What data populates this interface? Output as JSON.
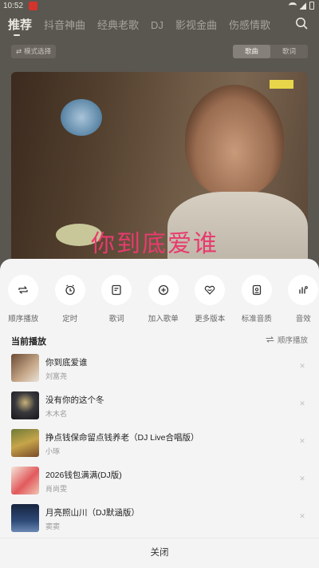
{
  "status_bar": {
    "time": "10:52"
  },
  "top_tabs": [
    "推荐",
    "抖音神曲",
    "经典老歌",
    "DJ",
    "影视金曲",
    "伤感情歌"
  ],
  "header": {
    "mode_label": "模式选择",
    "segments": [
      "歌曲",
      "歌词"
    ]
  },
  "cover": {
    "title_text": "你到底爱谁",
    "label_text": ""
  },
  "actions": [
    {
      "label": "顺序播放",
      "icon": "repeat-icon"
    },
    {
      "label": "定时",
      "icon": "timer-icon"
    },
    {
      "label": "歌词",
      "icon": "lyrics-icon"
    },
    {
      "label": "加入歌单",
      "icon": "add-icon"
    },
    {
      "label": "更多版本",
      "icon": "heart-versions-icon"
    },
    {
      "label": "标准音质",
      "icon": "quality-icon"
    },
    {
      "label": "音效",
      "icon": "sound-effect-icon"
    }
  ],
  "queue": {
    "title": "当前播放",
    "order_label": "顺序播放",
    "songs": [
      {
        "title": "你到底爱谁",
        "artist": "刘富尧"
      },
      {
        "title": "没有你的这个冬",
        "artist": "木木名"
      },
      {
        "title": "挣点钱保命留点钱养老（DJ Live合唱版）",
        "artist": "小琢"
      },
      {
        "title": "2026钱包满满(DJ版)",
        "artist": "肖尚雯"
      },
      {
        "title": "月亮照山川（DJ默涵版）",
        "artist": "窦窦"
      }
    ]
  },
  "close_label": "关闭",
  "colors": {
    "sheet_bg": "#f4f4f5",
    "accent_text": "#222222"
  }
}
